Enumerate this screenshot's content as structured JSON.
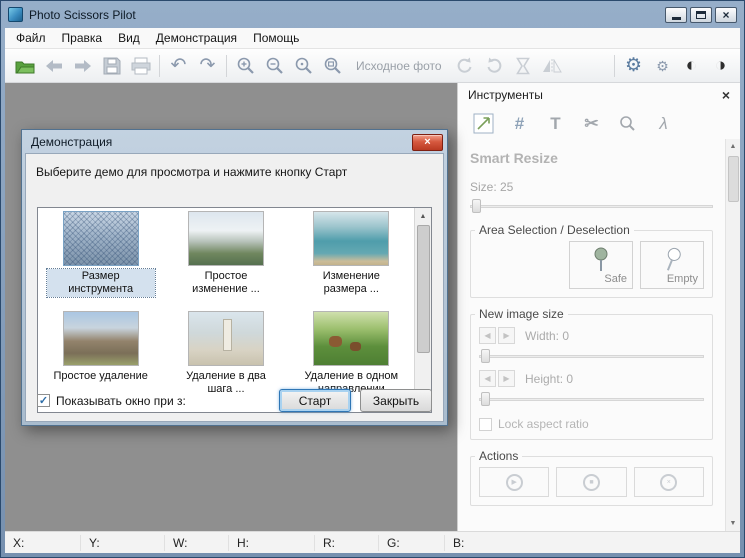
{
  "window": {
    "title": "Photo Scissors Pilot"
  },
  "menu": {
    "items": [
      "Файл",
      "Правка",
      "Вид",
      "Демонстрация",
      "Помощь"
    ]
  },
  "toolbar": {
    "source_photo_label": "Исходное фото"
  },
  "tools_panel": {
    "title": "Инструменты",
    "section_title": "Smart Resize",
    "size_label": "Size: 25",
    "groups": {
      "area": {
        "title": "Area Selection / Deselection",
        "safe_label": "Safe",
        "empty_label": "Empty"
      },
      "new_size": {
        "title": "New image size",
        "width_label": "Width: 0",
        "height_label": "Height: 0",
        "lock_label": "Lock aspect ratio",
        "lock_checked": false
      },
      "actions": {
        "title": "Actions"
      }
    }
  },
  "dialog": {
    "title": "Демонстрация",
    "prompt": "Выберите демо для просмотра и нажмите кнопку Старт",
    "items": [
      {
        "label": "Размер инструмента",
        "selected": true
      },
      {
        "label": "Простое изменение ...",
        "selected": false
      },
      {
        "label": "Изменение размера ...",
        "selected": false
      },
      {
        "label": "Простое удаление",
        "selected": false
      },
      {
        "label": "Удаление в два шага ...",
        "selected": false
      },
      {
        "label": "Удаление в одном направлении",
        "selected": false
      }
    ],
    "show_checkbox_label": "Показывать окно при з:",
    "checkbox_checked": true,
    "start_label": "Старт",
    "close_label": "Закрыть"
  },
  "statusbar": {
    "labels": [
      "X:",
      "Y:",
      "W:",
      "H:",
      "R:",
      "G:",
      "B:"
    ]
  },
  "icons": {
    "close": "×",
    "undo": "↶",
    "redo": "↷",
    "gear": "⚙",
    "contrast_half": "◐",
    "contrast_inverse": "◑",
    "grid": "#",
    "text": "T",
    "scissors": "✂",
    "path": "λ",
    "play": "▶",
    "stop": "■",
    "cancel": "×",
    "left": "◀",
    "right": "▶",
    "up": "▲",
    "down": "▼",
    "check": "✓"
  },
  "colors": {
    "titlebar": "#7d98b5",
    "canvas": "#8f8f8f",
    "dialog_close_red": "#ba3a22",
    "selection": "#d4e1ee",
    "default_button_border": "#2f76b5"
  }
}
